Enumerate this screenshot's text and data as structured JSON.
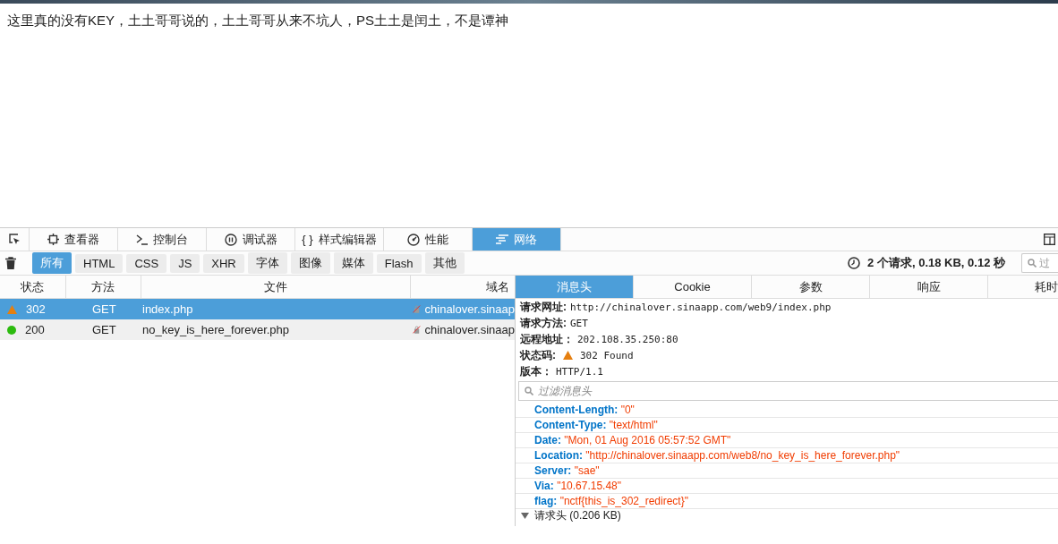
{
  "page": {
    "message": "这里真的没有KEY，土土哥哥说的，土土哥哥从来不坑人，PS土土是闰土，不是谭神"
  },
  "devtools": {
    "tabs": [
      {
        "label": "查看器",
        "selected": false
      },
      {
        "label": "控制台",
        "selected": false
      },
      {
        "label": "调试器",
        "selected": false
      },
      {
        "glyph": "{ }",
        "label": "样式编辑器",
        "selected": false
      },
      {
        "label": "性能",
        "selected": false
      },
      {
        "label": "网络",
        "selected": true
      }
    ],
    "filters": [
      {
        "label": "所有",
        "selected": true
      },
      {
        "label": "HTML",
        "selected": false
      },
      {
        "label": "CSS",
        "selected": false
      },
      {
        "label": "JS",
        "selected": false
      },
      {
        "label": "XHR",
        "selected": false
      },
      {
        "label": "字体",
        "selected": false
      },
      {
        "label": "图像",
        "selected": false
      },
      {
        "label": "媒体",
        "selected": false
      },
      {
        "label": "Flash",
        "selected": false
      },
      {
        "label": "其他",
        "selected": false
      }
    ],
    "summary": "2 个请求, 0.18 KB, 0.12 秒",
    "search": {
      "placeholder": "过"
    },
    "requests": {
      "columns": [
        "状态",
        "方法",
        "文件",
        "域名"
      ],
      "rows": [
        {
          "kind": "redirect",
          "status": "302",
          "method": "GET",
          "file": "index.php",
          "domain": "chinalover.sinaap",
          "selected": true
        },
        {
          "kind": "ok",
          "status": "200",
          "method": "GET",
          "file": "no_key_is_here_forever.php",
          "domain": "chinalover.sinaap",
          "selected": false
        }
      ]
    },
    "details": {
      "tabs": [
        {
          "label": "消息头",
          "selected": true
        },
        {
          "label": "Cookie",
          "selected": false
        },
        {
          "label": "参数",
          "selected": false
        },
        {
          "label": "响应",
          "selected": false
        },
        {
          "label": "耗时",
          "selected": false
        }
      ],
      "summary": [
        {
          "kind": "text",
          "label": "请求网址:",
          "value": "http://chinalover.sinaapp.com/web9/index.php"
        },
        {
          "kind": "text",
          "label": "请求方法:",
          "value": "GET"
        },
        {
          "kind": "text",
          "label": "远程地址：",
          "value": "202.108.35.250:80"
        },
        {
          "kind": "status",
          "label": "状态码:",
          "value": "302 Found"
        },
        {
          "kind": "text",
          "label": "版本：",
          "value": "HTTP/1.1"
        }
      ],
      "filter": {
        "placeholder": "过滤消息头"
      },
      "headers": [
        {
          "name": "Content-Length:",
          "value": "\"0\""
        },
        {
          "name": "Content-Type:",
          "value": "\"text/html\""
        },
        {
          "name": "Date:",
          "value": "\"Mon, 01 Aug 2016 05:57:52 GMT\""
        },
        {
          "name": "Location:",
          "value": "\"http://chinalover.sinaapp.com/web8/no_key_is_here_forever.php\""
        },
        {
          "name": "Server:",
          "value": "\"sae\""
        },
        {
          "name": "Via:",
          "value": "\"10.67.15.48\""
        },
        {
          "name": "flag:",
          "value": "\"nctf{this_is_302_redirect}\""
        }
      ],
      "section": {
        "label": "请求头 (0.206 KB)",
        "expanded": true
      }
    }
  }
}
